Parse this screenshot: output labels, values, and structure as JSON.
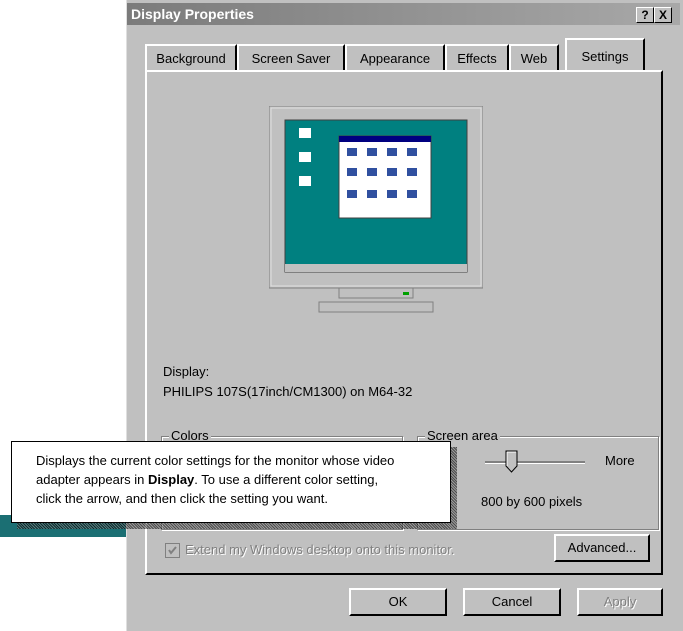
{
  "window": {
    "title": "Display Properties",
    "help_button": "?",
    "close_button": "X"
  },
  "tabs": [
    {
      "label": "Background"
    },
    {
      "label": "Screen Saver"
    },
    {
      "label": "Appearance"
    },
    {
      "label": "Effects"
    },
    {
      "label": "Web"
    },
    {
      "label": "Settings",
      "selected": true
    }
  ],
  "display": {
    "label": "Display:",
    "device": "PHILIPS 107S(17inch/CM1300) on M64-32"
  },
  "colors_group": {
    "label": "Colors"
  },
  "screen_area": {
    "label": "Screen area",
    "more_label": "More",
    "value_text": "800 by 600 pixels"
  },
  "extend_checkbox": {
    "label": "Extend my Windows desktop onto this monitor.",
    "checked": true,
    "disabled": true
  },
  "buttons": {
    "advanced": "Advanced...",
    "ok": "OK",
    "cancel": "Cancel",
    "apply": "Apply"
  },
  "tooltip": {
    "line1": "Displays the current color settings for the monitor whose video",
    "line2_pre": "adapter appears in ",
    "line2_bold": "Display",
    "line2_post": ". To use a different color setting,",
    "line3": "click the arrow, and then click the setting you want."
  },
  "colors": {
    "face": "#c0c0c0",
    "desktop_teal": "#008080",
    "title_gradient_start": "#7b7b7b"
  }
}
